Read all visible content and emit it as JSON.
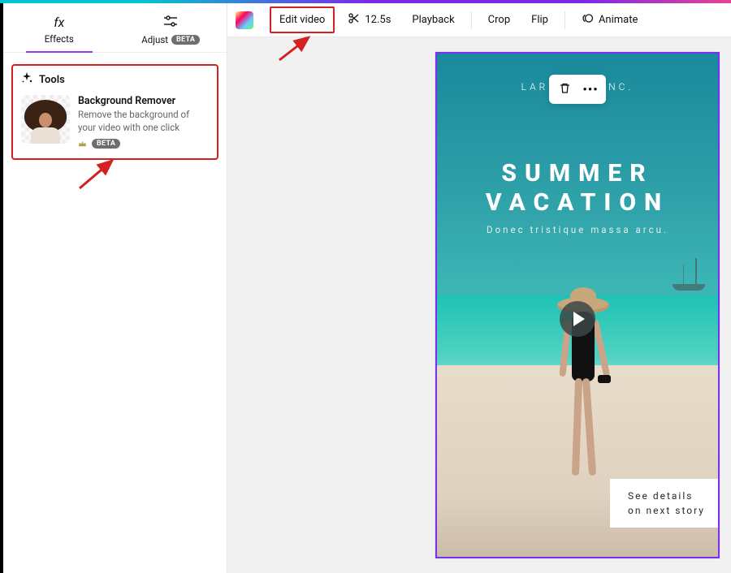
{
  "sidebar": {
    "tabs": {
      "effects": "Effects",
      "adjust": "Adjust",
      "adjust_badge": "BETA"
    },
    "tools_header": "Tools",
    "tool": {
      "title": "Background Remover",
      "desc": "Remove the background of your video with one click",
      "badge": "BETA"
    }
  },
  "toolbar": {
    "edit_video": "Edit video",
    "duration": "12.5s",
    "playback": "Playback",
    "crop": "Crop",
    "flip": "Flip",
    "animate": "Animate"
  },
  "design": {
    "brand_left": "LAR",
    "brand_right": "NC.",
    "headline_l1": "SUMMER",
    "headline_l2": "VACATION",
    "subline": "Donec tristique massa arcu.",
    "cta_l1": "See details",
    "cta_l2": "on next story"
  }
}
